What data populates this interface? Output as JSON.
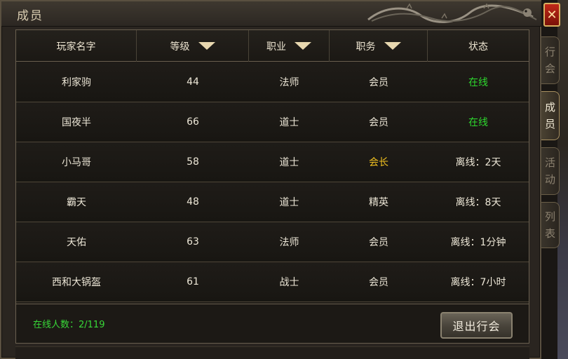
{
  "window": {
    "title": "成员",
    "close_label": "✕"
  },
  "side_tabs": [
    {
      "chars": [
        "行",
        "会"
      ],
      "active": false
    },
    {
      "chars": [
        "成",
        "员"
      ],
      "active": true
    },
    {
      "chars": [
        "活",
        "动"
      ],
      "active": false
    },
    {
      "chars": [
        "列",
        "表"
      ],
      "active": false
    }
  ],
  "table": {
    "headers": {
      "name": "玩家名字",
      "level": "等级",
      "job": "职业",
      "position": "职务",
      "status": "状态"
    },
    "rows": [
      {
        "name": "利家驹",
        "level": "44",
        "job": "法师",
        "position": "会员",
        "status": "在线"
      },
      {
        "name": "国夜半",
        "level": "66",
        "job": "道士",
        "position": "会员",
        "status": "在线"
      },
      {
        "name": "小马哥",
        "level": "58",
        "job": "道士",
        "position": "会长",
        "status": "离线：2天"
      },
      {
        "name": "霸天",
        "level": "48",
        "job": "道士",
        "position": "精英",
        "status": "离线：8天"
      },
      {
        "name": "天佑",
        "level": "63",
        "job": "法师",
        "position": "会员",
        "status": "离线：1分钟"
      },
      {
        "name": "西和大锅盔",
        "level": "61",
        "job": "战士",
        "position": "会员",
        "status": "离线：7小时"
      }
    ]
  },
  "footer": {
    "online_count": "在线人数：2/119",
    "quit_label": "退出行会"
  },
  "colors": {
    "online": "#2ed82e",
    "leader": "#f0c020",
    "default_text": "#ece6d6"
  },
  "icons": {
    "sort": "triangle-down",
    "close": "x-mark",
    "title_ornament": "dragon"
  }
}
